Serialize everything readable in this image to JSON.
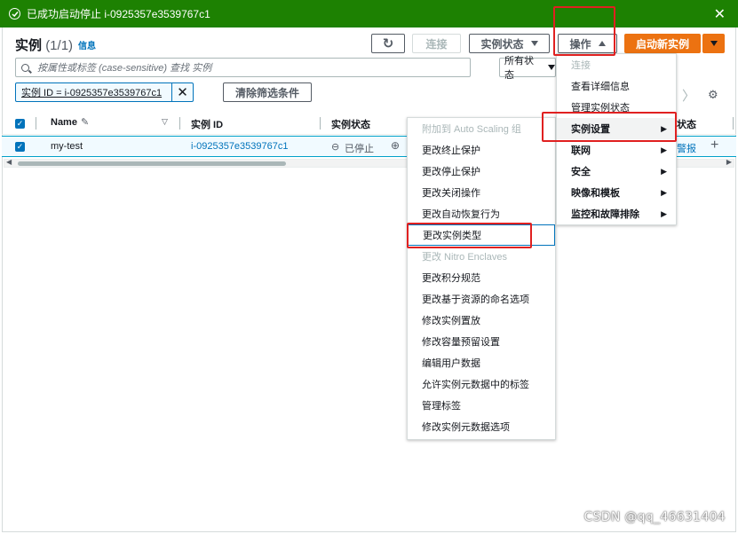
{
  "flash": {
    "message": "已成功启动停止 i-0925357e3539767c1",
    "close": "✕"
  },
  "header": {
    "title": "实例",
    "count": "(1/1)",
    "info": "信息"
  },
  "toolbar": {
    "refresh": "↻",
    "connect": "连接",
    "instance_state": "实例状态",
    "actions": "操作",
    "launch": "启动新实例"
  },
  "search": {
    "placeholder": "按属性或标签 (case-sensitive) 查找 实例"
  },
  "state_filter": {
    "value": "所有状态"
  },
  "filter_token": {
    "text": "实例 ID = i-0925357e3539767c1",
    "remove": "✕"
  },
  "clear_filters": "清除筛选条件",
  "pager_next": "〉",
  "settings_icon": "⚙",
  "table": {
    "columns": [
      "Name",
      "实例 ID",
      "实例状态",
      "状态"
    ],
    "rows": [
      {
        "name": "my-test",
        "instance_id": "i-0925357e3539767c1",
        "state": "已停止",
        "alarm": "警报",
        "add": "+"
      }
    ]
  },
  "actions_menu": {
    "items": [
      {
        "label": "连接",
        "disabled": true
      },
      {
        "label": "查看详细信息"
      },
      {
        "label": "管理实例状态"
      },
      {
        "label": "实例设置",
        "submenu": true
      },
      {
        "label": "联网",
        "submenu": true
      },
      {
        "label": "安全",
        "submenu": true
      },
      {
        "label": "映像和模板",
        "submenu": true
      },
      {
        "label": "监控和故障排除",
        "submenu": true
      }
    ]
  },
  "settings_submenu": {
    "items": [
      {
        "label": "附加到 Auto Scaling 组",
        "disabled": true
      },
      {
        "label": "更改终止保护"
      },
      {
        "label": "更改停止保护"
      },
      {
        "label": "更改关闭操作"
      },
      {
        "label": "更改自动恢复行为"
      },
      {
        "label": "更改实例类型"
      },
      {
        "label": "更改 Nitro Enclaves",
        "disabled": true
      },
      {
        "label": "更改积分规范"
      },
      {
        "label": "更改基于资源的命名选项"
      },
      {
        "label": "修改实例置放"
      },
      {
        "label": "修改容量预留设置"
      },
      {
        "label": "编辑用户数据"
      },
      {
        "label": "允许实例元数据中的标签"
      },
      {
        "label": "管理标签"
      },
      {
        "label": "修改实例元数据选项"
      }
    ]
  },
  "watermark": "CSDN @qq_46631404",
  "colors": {
    "success": "#1d8102",
    "primary": "#ec7211",
    "link": "#0073bb",
    "highlight": "#e02020"
  }
}
